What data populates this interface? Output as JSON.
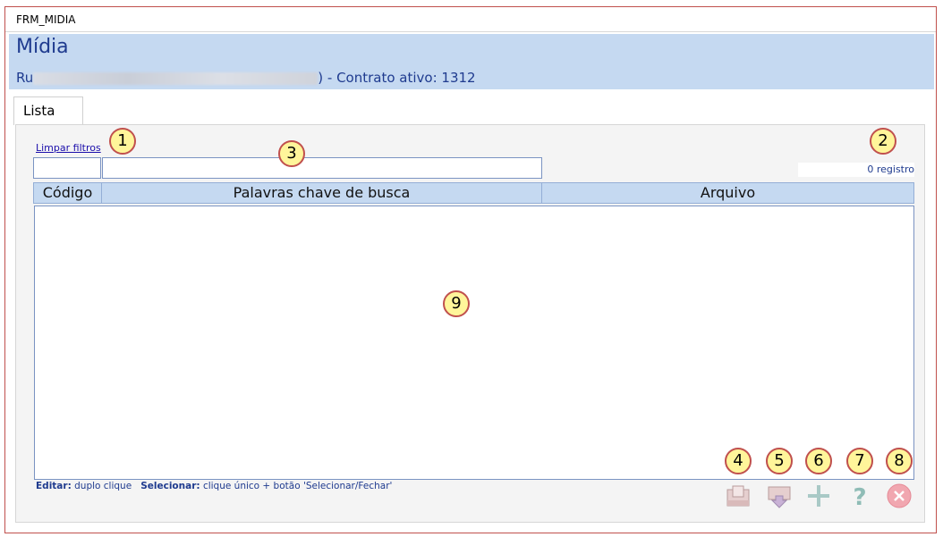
{
  "window": {
    "title": "FRM_MIDIA"
  },
  "header": {
    "title": "Mídia",
    "subtitle_prefix": "Ru",
    "subtitle_suffix": ") - Contrato ativo: 1312"
  },
  "tabs": [
    {
      "label": "Lista"
    }
  ],
  "filters": {
    "clear_link": "Limpar filtros",
    "codigo_value": "",
    "palavras_value": ""
  },
  "record_count": "0 registro",
  "table": {
    "columns": [
      "Código",
      "Palavras chave de busca",
      "Arquivo"
    ],
    "rows": []
  },
  "hint": {
    "edit_label": "Editar:",
    "edit_text": "duplo clique",
    "select_label": "Selecionar:",
    "select_text": "clique único + botão 'Selecionar/Fechar'"
  },
  "callouts": [
    "1",
    "2",
    "3",
    "4",
    "5",
    "6",
    "7",
    "8",
    "9"
  ],
  "toolbar": {
    "icons": [
      "open-folder-icon",
      "download-icon",
      "add-icon",
      "help-icon",
      "close-icon"
    ]
  },
  "colors": {
    "header_bg": "#c5d9f1",
    "header_text": "#1f3b8f",
    "frame_border": "#c0504d",
    "callout_fill": "#fff59a"
  }
}
